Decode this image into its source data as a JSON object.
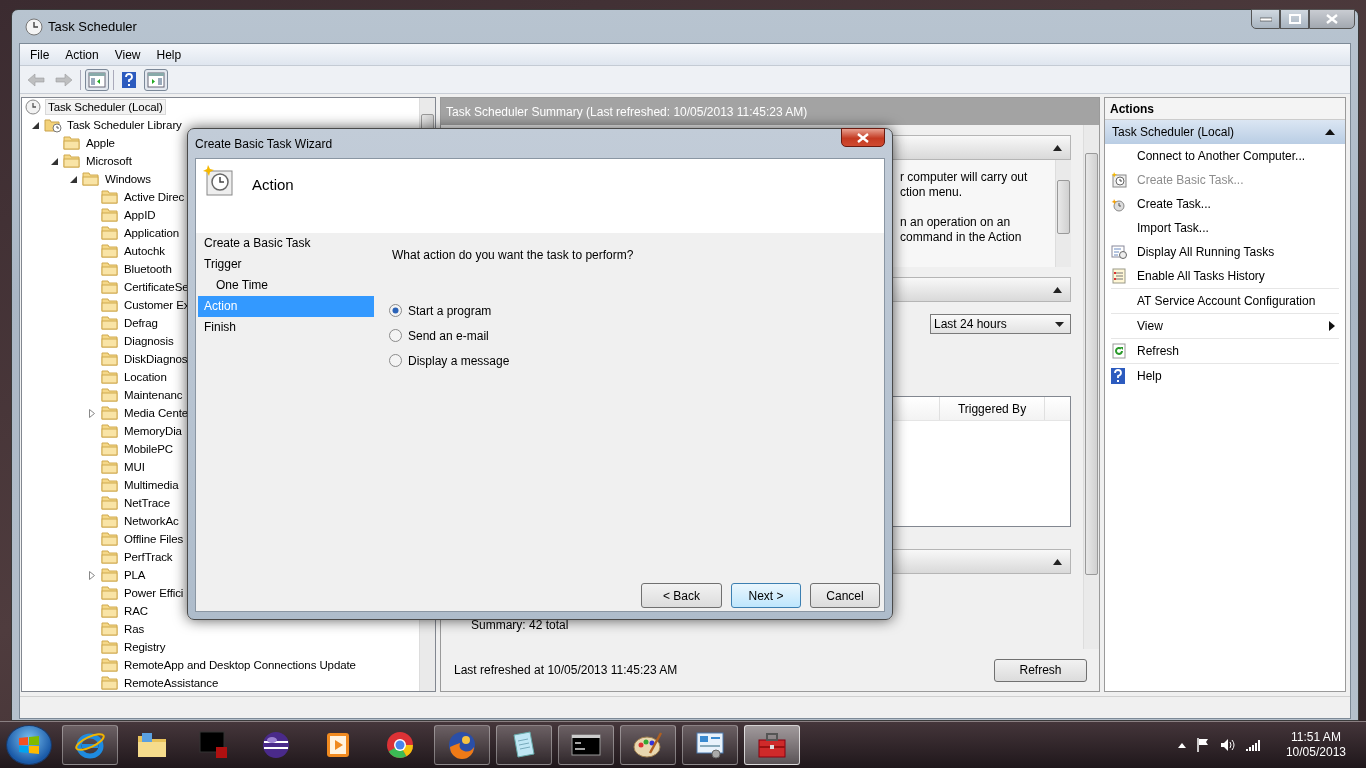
{
  "window": {
    "title": "Task Scheduler"
  },
  "menu": [
    "File",
    "Action",
    "View",
    "Help"
  ],
  "toolbar": {
    "back": {
      "disabled": true
    },
    "forward": {
      "disabled": true
    },
    "console_tree": {
      "pressed": true
    },
    "action_pane": {
      "pressed": true
    }
  },
  "tree": [
    {
      "label": "Task Scheduler (Local)",
      "selected": true,
      "children": [
        {
          "label": "Task Scheduler Library",
          "expanded": true,
          "selected": false,
          "children": [
            {
              "label": "Apple",
              "selected": false
            },
            {
              "label": "Microsoft",
              "expanded": true,
              "selected": false,
              "children": [
                {
                  "label": "Windows",
                  "expanded": true,
                  "selected": false,
                  "children": [
                    {
                      "label": "Active Direc",
                      "selected": false
                    },
                    {
                      "label": "AppID",
                      "selected": false
                    },
                    {
                      "label": "Application",
                      "selected": false
                    },
                    {
                      "label": "Autochk",
                      "selected": false
                    },
                    {
                      "label": "Bluetooth",
                      "selected": false
                    },
                    {
                      "label": "CertificateSe",
                      "selected": false
                    },
                    {
                      "label": "Customer Ex",
                      "selected": false
                    },
                    {
                      "label": "Defrag",
                      "selected": false
                    },
                    {
                      "label": "Diagnosis",
                      "selected": false
                    },
                    {
                      "label": "DiskDiagnos",
                      "selected": false
                    },
                    {
                      "label": "Location",
                      "selected": false
                    },
                    {
                      "label": "Maintenanc",
                      "selected": false
                    },
                    {
                      "label": "Media Cente",
                      "expanded": false,
                      "selected": false
                    },
                    {
                      "label": "MemoryDia",
                      "selected": false
                    },
                    {
                      "label": "MobilePC",
                      "selected": false
                    },
                    {
                      "label": "MUI",
                      "selected": false
                    },
                    {
                      "label": "Multimedia",
                      "selected": false
                    },
                    {
                      "label": "NetTrace",
                      "selected": false
                    },
                    {
                      "label": "NetworkAc",
                      "selected": false
                    },
                    {
                      "label": "Offline Files",
                      "selected": false
                    },
                    {
                      "label": "PerfTrack",
                      "selected": false
                    },
                    {
                      "label": "PLA",
                      "expanded": false,
                      "selected": false
                    },
                    {
                      "label": "Power Effici",
                      "selected": false
                    },
                    {
                      "label": "RAC",
                      "selected": false
                    },
                    {
                      "label": "Ras",
                      "selected": false
                    },
                    {
                      "label": "Registry",
                      "selected": false
                    },
                    {
                      "label": "RemoteApp and Desktop Connections Update",
                      "selected": false
                    },
                    {
                      "label": "RemoteAssistance",
                      "selected": false
                    }
                  ]
                }
              ]
            }
          ]
        }
      ]
    }
  ],
  "summary": {
    "title": "Task Scheduler Summary (Last refreshed: 10/05/2013 11:45:23 AM)",
    "overview": {
      "expanded": true,
      "lines": [
        "r computer will carry out",
        "ction menu.",
        "n an operation on an",
        "command in the Action"
      ]
    },
    "status": {
      "expanded": true,
      "range": "Last 24 hours",
      "columns": [
        "Triggered By"
      ]
    },
    "active": {
      "expanded": true,
      "summary": "Summary: 42 total"
    },
    "last_refreshed": "Last refreshed at 10/05/2013 11:45:23 AM",
    "refresh": "Refresh"
  },
  "actions": {
    "title": "Actions",
    "group": {
      "label": "Task Scheduler (Local)",
      "expanded": true
    },
    "items": [
      {
        "label": "Connect to Another Computer...",
        "disabled": false,
        "submenu": false
      },
      {
        "label": "Create Basic Task...",
        "disabled": true,
        "submenu": false
      },
      {
        "label": "Create Task...",
        "disabled": false,
        "submenu": false
      },
      {
        "label": "Import Task...",
        "disabled": false,
        "submenu": false
      },
      {
        "label": "Display All Running Tasks",
        "disabled": false,
        "submenu": false
      },
      {
        "label": "Enable All Tasks History",
        "disabled": false,
        "submenu": false
      },
      {
        "label": "AT Service Account Configuration",
        "disabled": false,
        "submenu": false
      },
      {
        "label": "View",
        "disabled": false,
        "submenu": true
      },
      {
        "label": "Refresh",
        "disabled": false,
        "submenu": false
      },
      {
        "label": "Help",
        "disabled": false,
        "submenu": false
      }
    ]
  },
  "dialog": {
    "title": "Create Basic Task Wizard",
    "heading": "Action",
    "steps": [
      {
        "label": "Create a Basic Task",
        "selected": false
      },
      {
        "label": "Trigger",
        "selected": false,
        "children": [
          {
            "label": "One Time",
            "selected": false
          }
        ]
      },
      {
        "label": "Action",
        "selected": true
      },
      {
        "label": "Finish",
        "selected": false
      }
    ],
    "question": "What action do you want the task to perform?",
    "options": [
      {
        "label": "Start a program",
        "selected": true
      },
      {
        "label": "Send an e-mail",
        "selected": false
      },
      {
        "label": "Display a message",
        "selected": false
      }
    ],
    "buttons": [
      {
        "label": "< Back",
        "default": false
      },
      {
        "label": "Next >",
        "default": true
      },
      {
        "label": "Cancel",
        "default": false
      }
    ]
  },
  "taskbar": {
    "items": [
      {
        "running": true,
        "active": false
      },
      {
        "running": false,
        "active": false
      },
      {
        "running": false,
        "active": false
      },
      {
        "running": false,
        "active": false
      },
      {
        "running": false,
        "active": false
      },
      {
        "running": false,
        "active": false
      },
      {
        "running": true,
        "active": false
      },
      {
        "running": true,
        "active": false
      },
      {
        "running": true,
        "active": false
      },
      {
        "running": true,
        "active": false
      },
      {
        "running": true,
        "active": false
      },
      {
        "running": true,
        "active": true
      }
    ],
    "clock": {
      "time": "11:51 AM",
      "date": "10/05/2013"
    }
  }
}
